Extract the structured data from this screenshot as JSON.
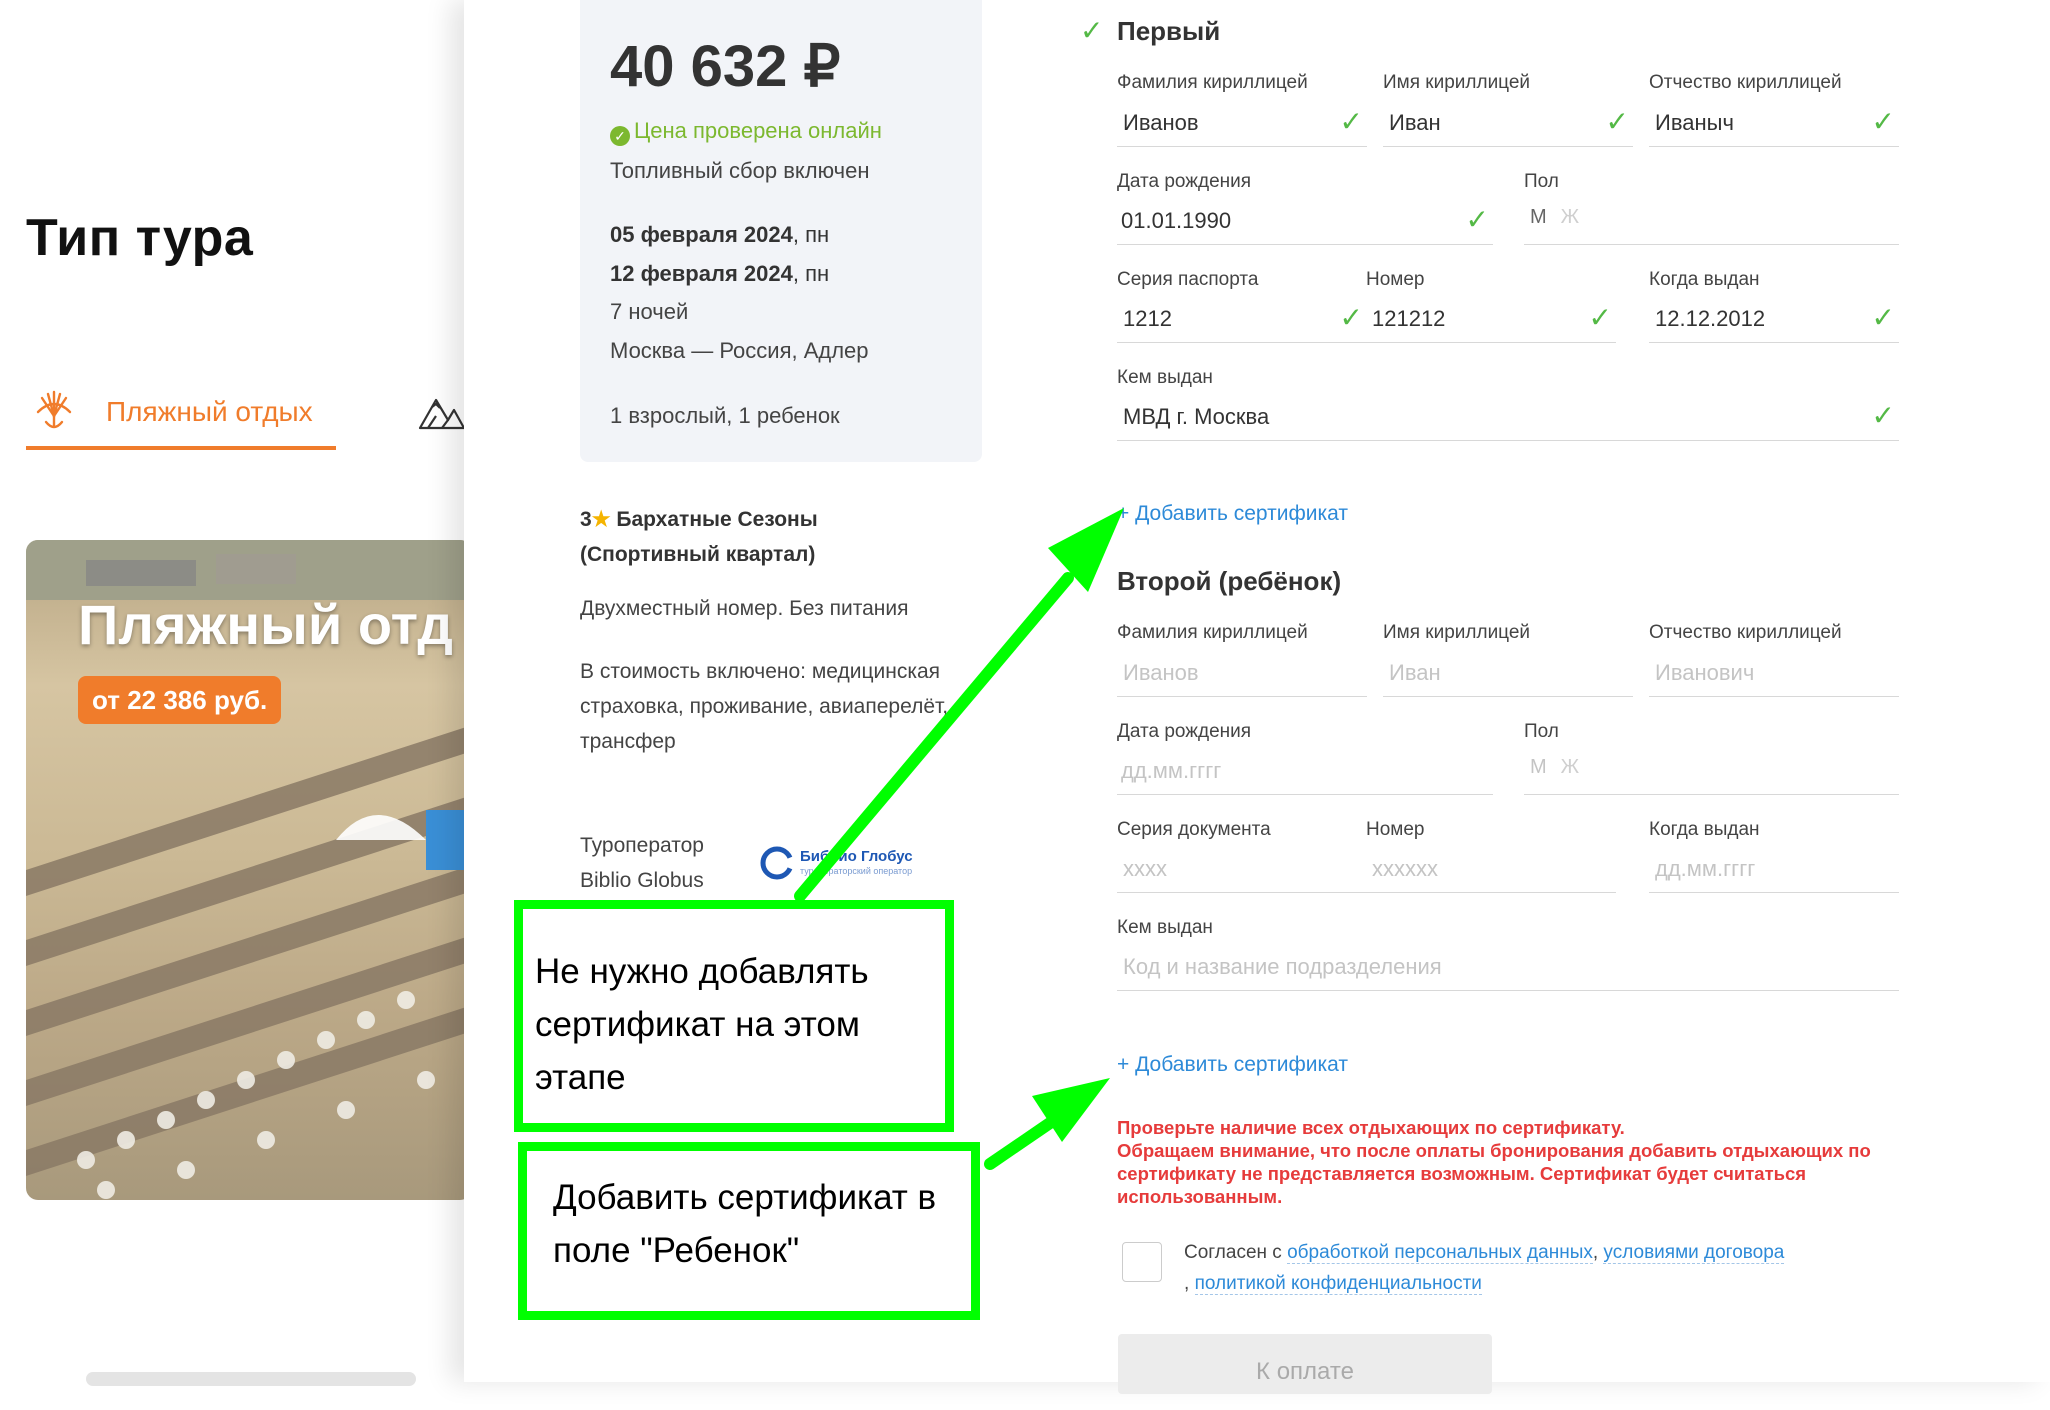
{
  "background": {
    "tour_type_heading": "Тип тура",
    "tab_beach_label": "Пляжный отдых",
    "promo": {
      "title": "Пляжный отд",
      "price": "от 22 386 руб."
    }
  },
  "summary": {
    "price": "40 632 ₽",
    "price_checked": "Цена проверена онлайн",
    "fuel_note": "Топливный сбор включен",
    "date_from": "05 февраля 2024",
    "date_from_day": ", пн",
    "date_to": "12 февраля 2024",
    "date_to_day": ", пн",
    "nights": "7 ночей",
    "route": "Москва — Россия, Адлер",
    "pax": "1 взрослый, 1 ребенок",
    "hotel_stars": "3",
    "hotel_name": "Бархатные Сезоны (Спортивный квартал)",
    "room_type": "Двухместный номер. Без питания",
    "included": "В стоимость включено: медицинская страховка, проживание, авиаперелёт, трансфер",
    "operator_label": "Туроператор",
    "operator_name": "Biblio Globus",
    "operator_logo_text": "Библио Глобус",
    "operator_logo_sub": "туроператорский оператор"
  },
  "form": {
    "first": {
      "title": "Первый",
      "labels": {
        "surname": "Фамилия кириллицей",
        "name": "Имя кириллицей",
        "patronymic": "Отчество кириллицей",
        "birth_date": "Дата рождения",
        "gender": "Пол",
        "series": "Серия паспорта",
        "number": "Номер",
        "issued_date": "Когда выдан",
        "issued_by": "Кем выдан"
      },
      "values": {
        "surname": "Иванов",
        "name": "Иван",
        "patronymic": "Иваныч",
        "birth_date": "01.01.1990",
        "series": "1212",
        "number": "121212",
        "issued_date": "12.12.2012",
        "issued_by": "МВД г. Москва"
      },
      "gender_m": "М",
      "gender_f": "Ж",
      "add_cert": "+ Добавить сертификат"
    },
    "second": {
      "title": "Второй (ребёнок)",
      "labels": {
        "surname": "Фамилия кириллицей",
        "name": "Имя кириллицей",
        "patronymic": "Отчество кириллицей",
        "birth_date": "Дата рождения",
        "gender": "Пол",
        "series": "Серия документа",
        "number": "Номер",
        "issued_date": "Когда выдан",
        "issued_by": "Кем выдан"
      },
      "placeholders": {
        "surname": "Иванов",
        "name": "Иван",
        "patronymic": "Иванович",
        "birth_date": "дд.мм.гггг",
        "series": "xxxx",
        "number": "xxxxxx",
        "issued_date": "дд.мм.гггг",
        "issued_by": "Код и название подразделения"
      },
      "gender_m": "М",
      "gender_f": "Ж",
      "add_cert": "+ Добавить сертификат"
    },
    "warning_line1": "Проверьте наличие всех отдыхающих по сертификату.",
    "warning_line2": "Обращаем внимание, что после оплаты бронирования добавить отдыхающих по сертификату не представляется возможным. Сертификат будет считаться использованным.",
    "consent_prefix": "Согласен с ",
    "consent_link1": "обработкой персональных данных",
    "consent_sep1": ", ",
    "consent_link2": "условиями договора",
    "consent_sep2": " , ",
    "consent_link3": "политикой конфиденциальности",
    "pay_label": "К оплате"
  },
  "annotations": {
    "top_note": "Не нужно добавлять сертификат на этом этапе",
    "bottom_note": "Добавить сертификат в поле \"Ребенок\"",
    "color": "#00ff00"
  },
  "colors": {
    "accent": "#f07c2b",
    "link": "#2d8ad8",
    "ok": "#54b946",
    "warning": "#e63b3b"
  }
}
